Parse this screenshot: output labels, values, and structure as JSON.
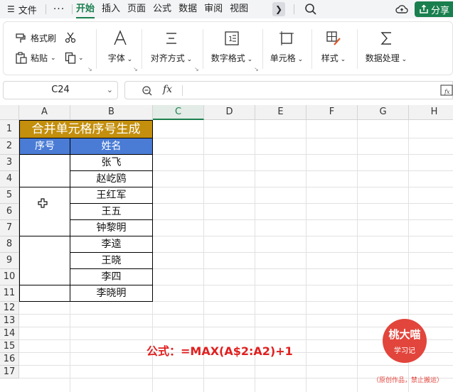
{
  "menu": {
    "file_label": "文件",
    "more_label": "···",
    "tabs": [
      "开始",
      "插入",
      "页面",
      "公式",
      "数据",
      "审阅",
      "视图"
    ],
    "share_label": "分享",
    "accent_color": "#1a7f4e"
  },
  "ribbon": {
    "format_painter": "格式刷",
    "paste": "粘贴",
    "font": "字体",
    "align": "对齐方式",
    "number_format": "数字格式",
    "cell": "单元格",
    "style": "样式",
    "data_process": "数据处理"
  },
  "formula_bar": {
    "name_box": "C24",
    "fx_label": "fx",
    "value": ""
  },
  "grid": {
    "columns": [
      "A",
      "B",
      "C",
      "D",
      "E",
      "F",
      "G",
      "H"
    ],
    "selected_column": "C",
    "rows": [
      "1",
      "2",
      "3",
      "4",
      "5",
      "6",
      "7",
      "8",
      "9",
      "10",
      "11",
      "12",
      "13",
      "14",
      "15",
      "16",
      "17"
    ]
  },
  "table": {
    "title": "合并单元格序号生成",
    "header_seq": "序号",
    "header_name": "姓名",
    "names": [
      "张飞",
      "赵屹鸥",
      "王红军",
      "王五",
      "钟黎明",
      "李逵",
      "王晓",
      "李四",
      "李晓明"
    ],
    "title_color": "#c38f0c",
    "header_color": "#4a7cd6"
  },
  "formula_note": "公式：=MAX(A$2:A2)+1",
  "watermark": {
    "title": "桃大喵",
    "subtitle": "学习记",
    "note": "（原创作品，禁止搬运）"
  }
}
